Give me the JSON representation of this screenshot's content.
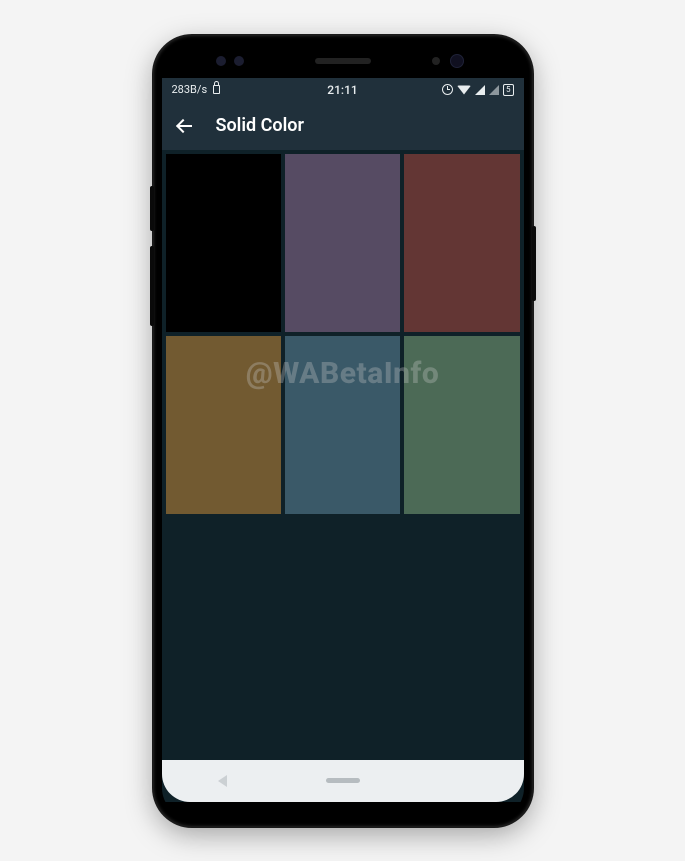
{
  "status_bar": {
    "net_speed": "283B/s",
    "time": "21:11",
    "battery_label": "5"
  },
  "app_bar": {
    "title": "Solid Color"
  },
  "watermark": "@WABetaInfo",
  "colors": [
    {
      "name": "black",
      "hex": "#000000"
    },
    {
      "name": "muted-purple",
      "hex": "#564b63"
    },
    {
      "name": "dark-maroon",
      "hex": "#633634"
    },
    {
      "name": "olive-brown",
      "hex": "#725a31"
    },
    {
      "name": "slate-blue",
      "hex": "#3a5968"
    },
    {
      "name": "muted-green",
      "hex": "#4c6a56"
    }
  ]
}
